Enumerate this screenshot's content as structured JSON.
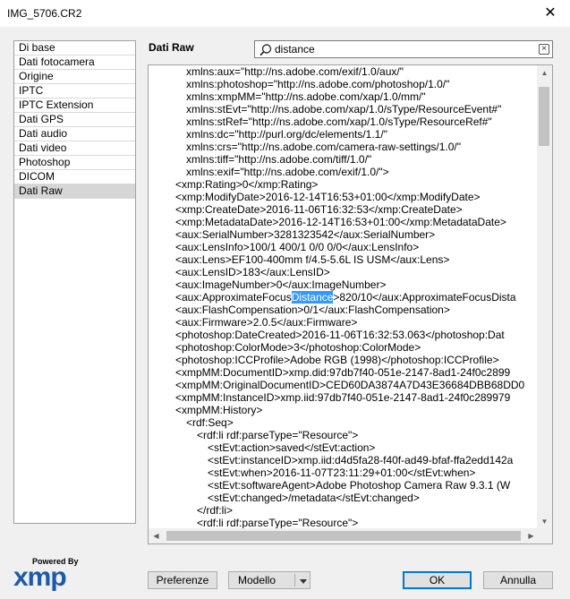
{
  "window": {
    "title": "IMG_5706.CR2"
  },
  "sidebar": {
    "items": [
      {
        "label": "Di base"
      },
      {
        "label": "Dati fotocamera"
      },
      {
        "label": "Origine"
      },
      {
        "label": "IPTC"
      },
      {
        "label": "IPTC Extension"
      },
      {
        "label": "Dati GPS"
      },
      {
        "label": "Dati audio"
      },
      {
        "label": "Dati video"
      },
      {
        "label": "Photoshop"
      },
      {
        "label": "DICOM"
      },
      {
        "label": "Dati Raw",
        "selected": true
      }
    ]
  },
  "panel": {
    "title": "Dati Raw"
  },
  "search": {
    "value": "distance"
  },
  "xml_lines": [
    {
      "text": "xmlns:aux=\"http://ns.adobe.com/exif/1.0/aux/\"",
      "indent": 3
    },
    {
      "text": "xmlns:photoshop=\"http://ns.adobe.com/photoshop/1.0/\"",
      "indent": 3
    },
    {
      "text": "xmlns:xmpMM=\"http://ns.adobe.com/xap/1.0/mm/\"",
      "indent": 3
    },
    {
      "text": "xmlns:stEvt=\"http://ns.adobe.com/xap/1.0/sType/ResourceEvent#\"",
      "indent": 3
    },
    {
      "text": "xmlns:stRef=\"http://ns.adobe.com/xap/1.0/sType/ResourceRef#\"",
      "indent": 3
    },
    {
      "text": "xmlns:dc=\"http://purl.org/dc/elements/1.1/\"",
      "indent": 3
    },
    {
      "text": "xmlns:crs=\"http://ns.adobe.com/camera-raw-settings/1.0/\"",
      "indent": 3
    },
    {
      "text": "xmlns:tiff=\"http://ns.adobe.com/tiff/1.0/\"",
      "indent": 3
    },
    {
      "text": "xmlns:exif=\"http://ns.adobe.com/exif/1.0/\">",
      "indent": 3
    },
    {
      "text": "<xmp:Rating>0</xmp:Rating>",
      "indent": 2
    },
    {
      "text": "<xmp:ModifyDate>2016-12-14T16:53+01:00</xmp:ModifyDate>",
      "indent": 2
    },
    {
      "text": "<xmp:CreateDate>2016-11-06T16:32:53</xmp:CreateDate>",
      "indent": 2
    },
    {
      "text": "<xmp:MetadataDate>2016-12-14T16:53+01:00</xmp:MetadataDate>",
      "indent": 2
    },
    {
      "text": "<aux:SerialNumber>3281323542</aux:SerialNumber>",
      "indent": 2
    },
    {
      "text": "<aux:LensInfo>100/1 400/1 0/0 0/0</aux:LensInfo>",
      "indent": 2
    },
    {
      "text": "<aux:Lens>EF100-400mm f/4.5-5.6L IS USM</aux:Lens>",
      "indent": 2
    },
    {
      "text": "<aux:LensID>183</aux:LensID>",
      "indent": 2
    },
    {
      "text": "<aux:ImageNumber>0</aux:ImageNumber>",
      "indent": 2
    },
    {
      "text": "<aux:ApproximateFocus",
      "hl": "Distance",
      "after": ">820/10</aux:ApproximateFocusDista",
      "indent": 2
    },
    {
      "text": "<aux:FlashCompensation>0/1</aux:FlashCompensation>",
      "indent": 2
    },
    {
      "text": "<aux:Firmware>2.0.5</aux:Firmware>",
      "indent": 2
    },
    {
      "text": "<photoshop:DateCreated>2016-11-06T16:32:53.063</photoshop:Dat",
      "indent": 2
    },
    {
      "text": "<photoshop:ColorMode>3</photoshop:ColorMode>",
      "indent": 2
    },
    {
      "text": "<photoshop:ICCProfile>Adobe RGB (1998)</photoshop:ICCProfile>",
      "indent": 2
    },
    {
      "text": "<xmpMM:DocumentID>xmp.did:97db7f40-051e-2147-8ad1-24f0c2899",
      "indent": 2
    },
    {
      "text": "<xmpMM:OriginalDocumentID>CED60DA3874A7D43E36684DBB68DD0",
      "indent": 2
    },
    {
      "text": "<xmpMM:InstanceID>xmp.iid:97db7f40-051e-2147-8ad1-24f0c289979",
      "indent": 2
    },
    {
      "text": "<xmpMM:History>",
      "indent": 2
    },
    {
      "text": "<rdf:Seq>",
      "indent": 3
    },
    {
      "text": "<rdf:li rdf:parseType=\"Resource\">",
      "indent": 4
    },
    {
      "text": "<stEvt:action>saved</stEvt:action>",
      "indent": 5
    },
    {
      "text": "<stEvt:instanceID>xmp.iid:d4d5fa28-f40f-ad49-bfaf-ffa2edd142a",
      "indent": 5
    },
    {
      "text": "<stEvt:when>2016-11-07T23:11:29+01:00</stEvt:when>",
      "indent": 5
    },
    {
      "text": "<stEvt:softwareAgent>Adobe Photoshop Camera Raw 9.3.1 (W",
      "indent": 5
    },
    {
      "text": "<stEvt:changed>/metadata</stEvt:changed>",
      "indent": 5
    },
    {
      "text": "</rdf:li>",
      "indent": 4
    },
    {
      "text": "<rdf:li rdf:parseType=\"Resource\">",
      "indent": 4
    }
  ],
  "logo": {
    "powered_by": "Powered By",
    "word": "xmp"
  },
  "buttons": {
    "preferences": "Preferenze",
    "template": "Modello",
    "ok": "OK",
    "cancel": "Annulla"
  }
}
